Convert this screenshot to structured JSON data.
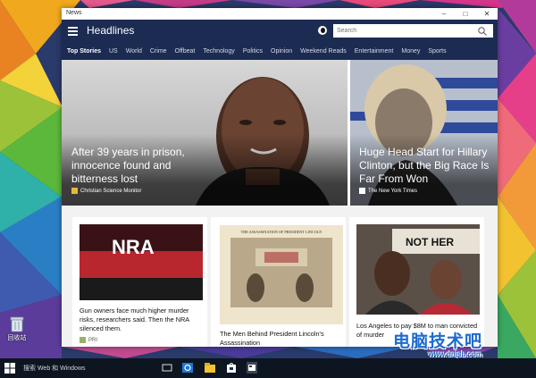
{
  "desktop": {
    "recycle_bin_label": "回收站",
    "colors": {
      "pink": "#e63f8a",
      "purple": "#6a3ea0",
      "yellow": "#f2c230",
      "teal": "#2fb0a8",
      "green": "#5cb83a"
    }
  },
  "window": {
    "title": "News",
    "controls": {
      "minimize": "–",
      "maximize": "□",
      "close": "✕"
    }
  },
  "header": {
    "title": "Headlines",
    "search_placeholder": "Search",
    "accent": "#1c2b52"
  },
  "nav": {
    "categories": [
      {
        "label": "Top Stories",
        "active": true
      },
      {
        "label": "US"
      },
      {
        "label": "World"
      },
      {
        "label": "Crime"
      },
      {
        "label": "Offbeat"
      },
      {
        "label": "Technology"
      },
      {
        "label": "Politics"
      },
      {
        "label": "Opinion"
      },
      {
        "label": "Weekend Reads"
      },
      {
        "label": "Entertainment"
      },
      {
        "label": "Money"
      },
      {
        "label": "Sports"
      }
    ]
  },
  "hero": [
    {
      "title": "After 39 years in prison, innocence found and bitterness lost",
      "source": "Christian Science Monitor",
      "source_icon": "monitor-logo-icon"
    },
    {
      "title": "Huge Head Start for Hillary Clinton, but the Big Race Is Far From Won",
      "source": "The New York Times",
      "source_icon": "nyt-logo-icon"
    }
  ],
  "cards": [
    {
      "title": "Gun owners face much higher murder risks, researchers said. Then the NRA silenced them.",
      "source": "PRI",
      "image_text": "NRA"
    },
    {
      "title": "The Men Behind President Lincoln's Assassination",
      "source": "",
      "image_text": "THE ASSASSINATION OF PRESIDENT LINCOLN"
    },
    {
      "title": "Los Angeles to pay $8M to man convicted of murder",
      "source": "",
      "image_text": "NOT HER"
    }
  ],
  "taskbar": {
    "search_text": "搜索 Web 和 Windows"
  },
  "watermark": {
    "text": "电脑技术吧",
    "url": "www.dnjsb.com"
  }
}
